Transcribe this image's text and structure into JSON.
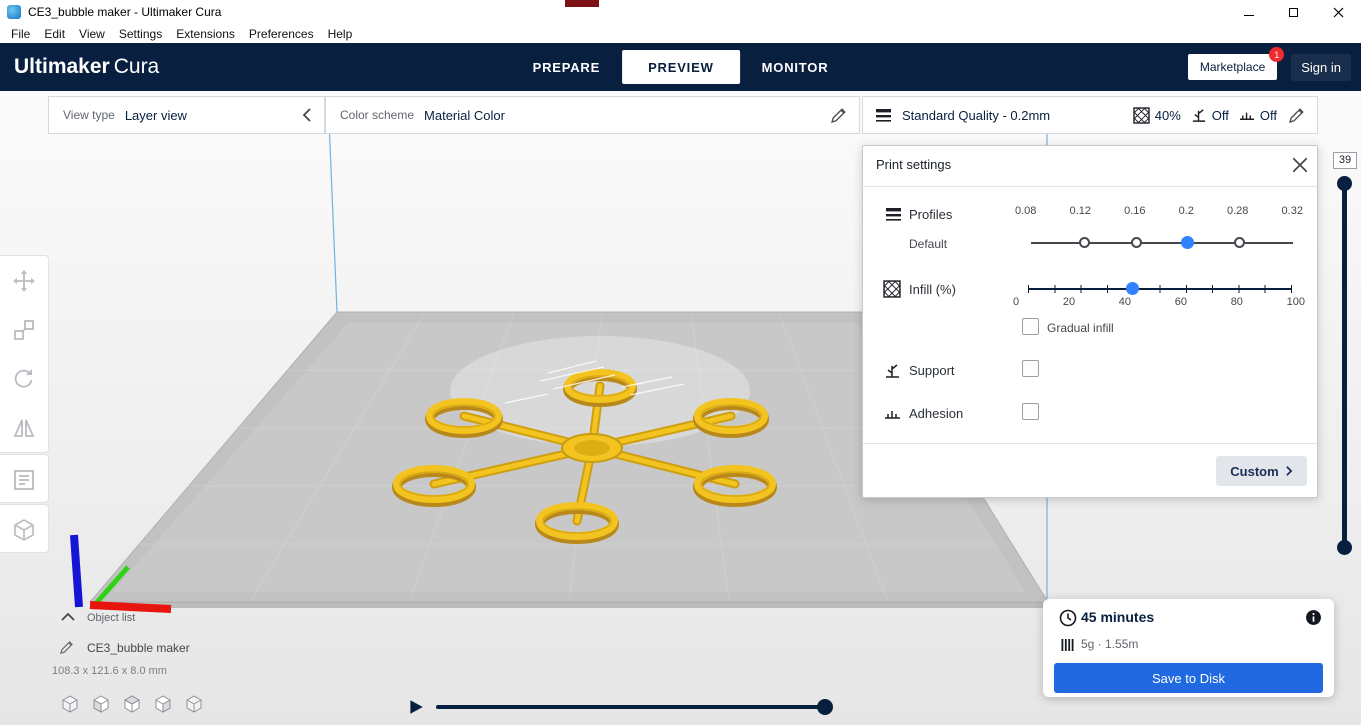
{
  "colors": {
    "header_navy": "#081F3F",
    "accent_blue": "#3282FF",
    "model_yellow": "#F3C31F",
    "save_button_blue": "#2169E0",
    "badge_red": "#EF2B2D"
  },
  "titlebar": {
    "title": "CE3_bubble maker - Ultimaker Cura"
  },
  "menubar": {
    "items": [
      "File",
      "Edit",
      "View",
      "Settings",
      "Extensions",
      "Preferences",
      "Help"
    ]
  },
  "header": {
    "logo_primary": "Ultimaker",
    "logo_secondary": "Cura",
    "tabs": [
      {
        "label": "PREPARE",
        "active": false
      },
      {
        "label": "PREVIEW",
        "active": true
      },
      {
        "label": "MONITOR",
        "active": false
      }
    ],
    "marketplace_label": "Marketplace",
    "marketplace_badge": "1",
    "signin_label": "Sign in"
  },
  "view_toolbar": {
    "view_type_label": "View type",
    "view_type_value": "Layer view",
    "color_scheme_label": "Color scheme",
    "color_scheme_value": "Material Color"
  },
  "print_setup_summary": {
    "profile": "Standard Quality - 0.2mm",
    "infill": "40%",
    "support": "Off",
    "adhesion": "Off"
  },
  "print_settings": {
    "title": "Print settings",
    "profiles_label": "Profiles",
    "default_label": "Default",
    "profile_options": [
      "0.08",
      "0.12",
      "0.16",
      "0.2",
      "0.28",
      "0.32"
    ],
    "selected_profile": "0.2",
    "infill_label": "Infill (%)",
    "infill_value": 40,
    "infill_ticks": [
      "0",
      "20",
      "40",
      "60",
      "80",
      "100"
    ],
    "gradual_infill_label": "Gradual infill",
    "gradual_infill_checked": false,
    "support_label": "Support",
    "support_checked": false,
    "adhesion_label": "Adhesion",
    "adhesion_checked": false,
    "custom_button_label": "Custom"
  },
  "layer_slider": {
    "current_layer": "39"
  },
  "object_list": {
    "header_label": "Object list",
    "object_name": "CE3_bubble maker",
    "object_dimensions": "108.3 x 121.6 x 8.0 mm"
  },
  "output_panel": {
    "print_time": "45 minutes",
    "material_usage": "5g · 1.55m",
    "save_button_label": "Save to Disk"
  }
}
